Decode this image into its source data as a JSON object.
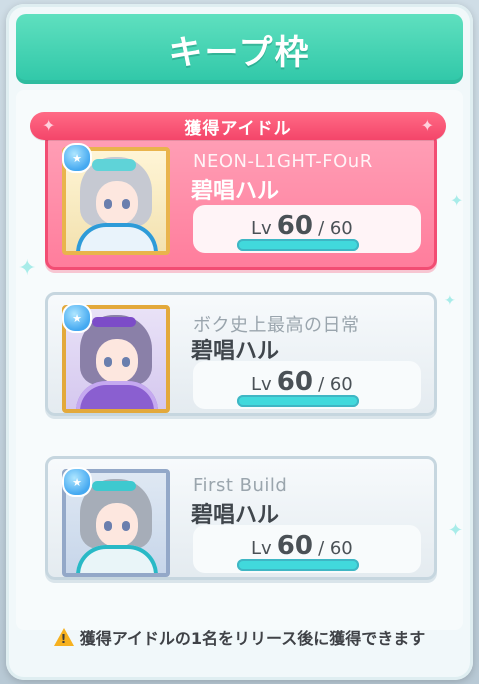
{
  "header": {
    "title": "キープ枠"
  },
  "ribbon": {
    "label": "獲得アイドル"
  },
  "cards": [
    {
      "title": "NEON-L1GHT-FOuR",
      "name": "碧唱ハル",
      "level_label": "Lv",
      "level": "60",
      "level_max": "/ 60",
      "progress": 1.0,
      "state": "selected"
    },
    {
      "title": "ボク史上最高の日常",
      "name": "碧唱ハル",
      "level_label": "Lv",
      "level": "60",
      "level_max": "/ 60",
      "progress": 1.0,
      "state": "normal"
    },
    {
      "title": "First Build",
      "name": "碧唱ハル",
      "level_label": "Lv",
      "level": "60",
      "level_max": "/ 60",
      "progress": 1.0,
      "state": "normal"
    }
  ],
  "footer": {
    "notice": "獲得アイドルの1名をリリース後に獲得できます"
  },
  "colors": {
    "accent_green": "#2fc7a8",
    "accent_pink": "#f24d73",
    "level_bar": "#41d9dc",
    "warning": "#f6b11f"
  }
}
